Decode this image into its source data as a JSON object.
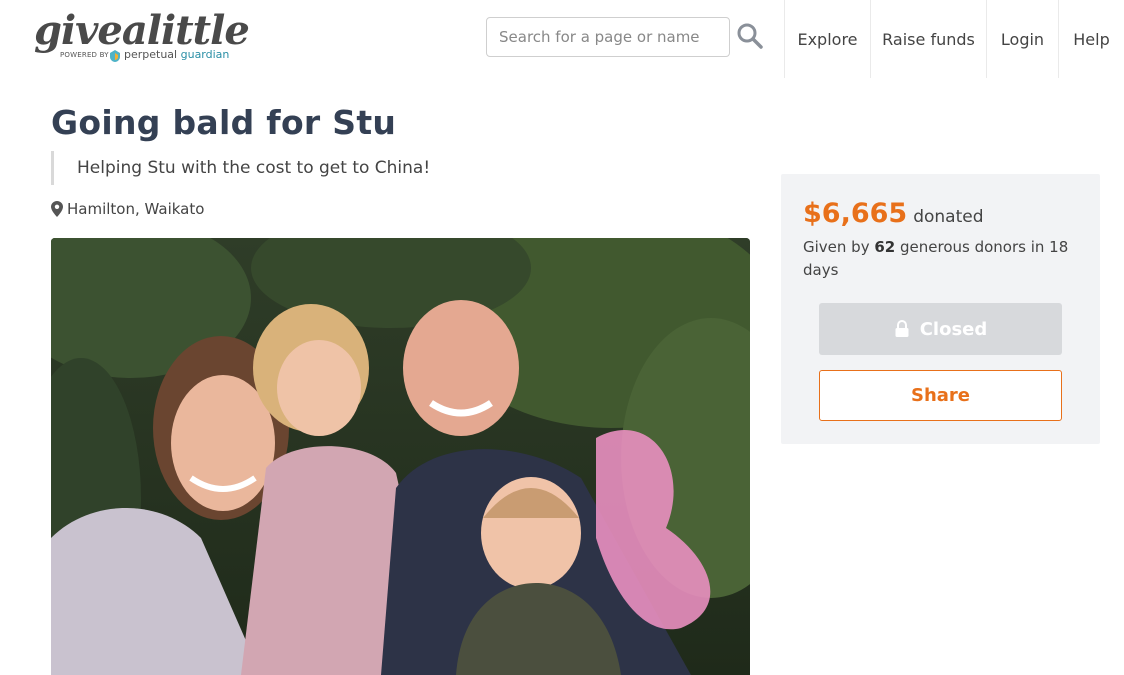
{
  "header": {
    "logo_text": "givealittle",
    "logo_powered": "POWERED BY",
    "logo_brand_a": "perpetual",
    "logo_brand_b": "guardian",
    "search_placeholder": "Search for a page or name",
    "nav": [
      "Explore",
      "Raise funds",
      "Login",
      "Help"
    ]
  },
  "page": {
    "title": "Going bald for Stu",
    "subtitle": "Helping Stu with the cost to get to China!",
    "location": "Hamilton, Waikato"
  },
  "donation": {
    "amount": "$6,665",
    "amount_label": "donated",
    "donors_prefix": "Given by",
    "donor_count": "62",
    "donors_suffix": "generous donors in 18 days",
    "closed_label": "Closed",
    "share_label": "Share"
  },
  "colors": {
    "accent": "#e8701a",
    "title": "#344054",
    "panel_bg": "#f2f3f5"
  },
  "icons": {
    "search": "search-icon",
    "location": "map-pin-icon",
    "lock": "lock-icon"
  }
}
